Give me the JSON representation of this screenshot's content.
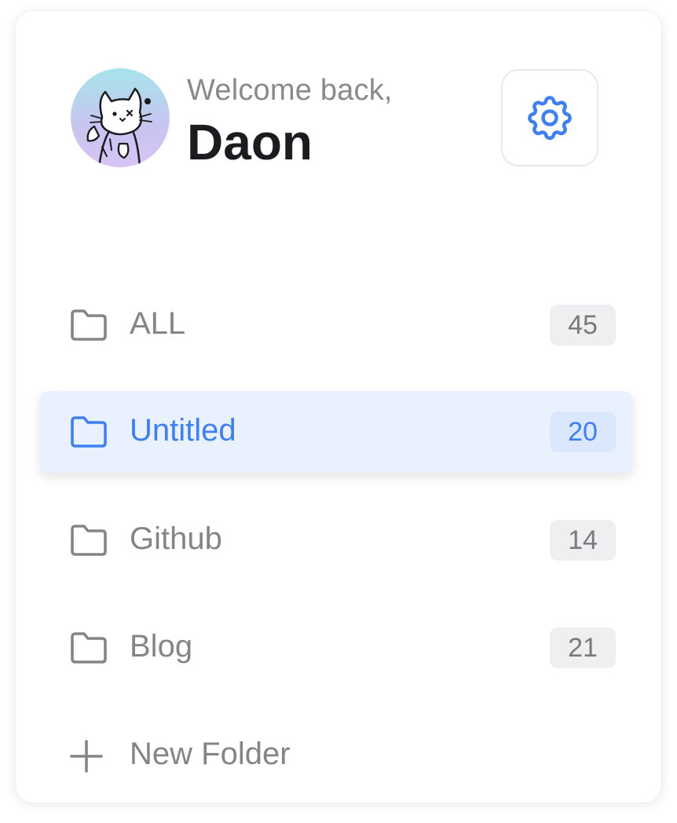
{
  "header": {
    "welcome_text": "Welcome back,",
    "user_name": "Daon"
  },
  "icons": {
    "avatar": "cat-avatar-icon",
    "settings": "gear-icon",
    "folder": "folder-icon",
    "add": "plus-icon"
  },
  "folders": [
    {
      "label": "ALL",
      "count": "45",
      "active": false
    },
    {
      "label": "Untitled",
      "count": "20",
      "active": true
    },
    {
      "label": "Github",
      "count": "14",
      "active": false
    },
    {
      "label": "Blog",
      "count": "21",
      "active": false
    }
  ],
  "new_folder_label": "New Folder",
  "colors": {
    "accent": "#3f7ff0",
    "active_bg": "#eaf1fe",
    "muted_text": "#858589",
    "badge_bg": "#efeff1"
  }
}
